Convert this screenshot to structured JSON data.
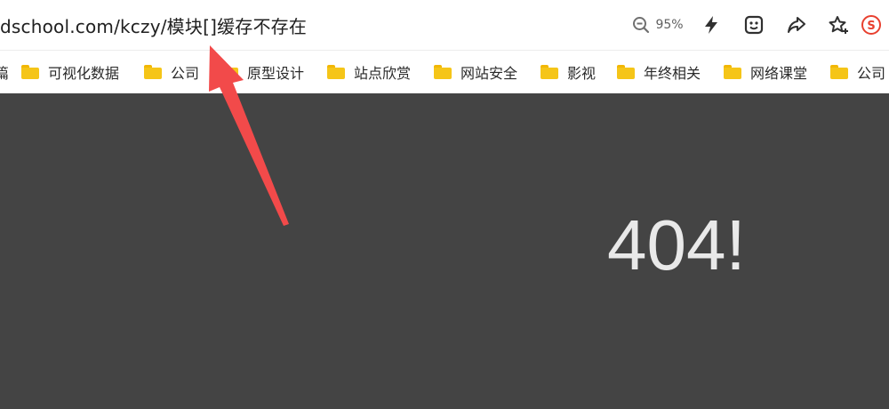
{
  "address_bar": {
    "url": "dschool.com/kczy/模块[]缓存不存在"
  },
  "toolbar": {
    "zoom_level": "95%",
    "icons": [
      "zoom-out-icon",
      "lightning-icon",
      "smiley-icon",
      "share-icon",
      "star-add-icon",
      "sogou-icon"
    ]
  },
  "bookmarks": {
    "items": [
      {
        "label": "篇",
        "has_folder": false
      },
      {
        "label": "可视化数据",
        "has_folder": true
      },
      {
        "label": "公司",
        "has_folder": true
      },
      {
        "label": "原型设计",
        "has_folder": true
      },
      {
        "label": "站点欣赏",
        "has_folder": true
      },
      {
        "label": "网站安全",
        "has_folder": true
      },
      {
        "label": "影视",
        "has_folder": true
      },
      {
        "label": "年终相关",
        "has_folder": true
      },
      {
        "label": "网络课堂",
        "has_folder": true
      },
      {
        "label": "公司",
        "has_folder": true
      }
    ]
  },
  "page": {
    "error_text": "404!",
    "background": "#444444"
  },
  "annotation": {
    "arrow_color": "#f24a4a"
  }
}
